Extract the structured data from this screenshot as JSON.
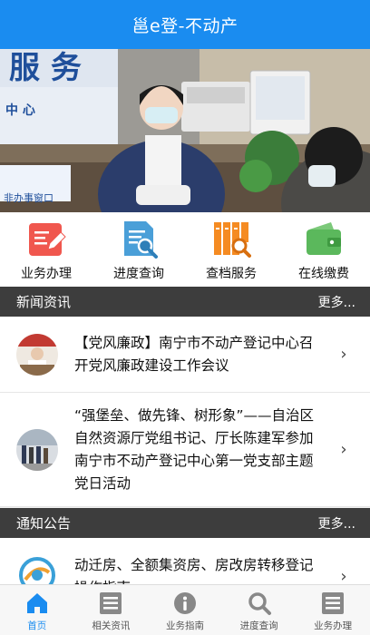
{
  "header": {
    "title": "邕e登-不动产"
  },
  "banner": {
    "sign_big": "服 务",
    "sign_small": "中 心",
    "desk_label": "非办事窗口"
  },
  "quick_actions": [
    {
      "label": "业务办理",
      "icon": "edit-icon",
      "color": "#f0574e"
    },
    {
      "label": "进度查询",
      "icon": "document-search-icon",
      "color": "#4a9fd8"
    },
    {
      "label": "查档服务",
      "icon": "archive-search-icon",
      "color": "#f58b22"
    },
    {
      "label": "在线缴费",
      "icon": "wallet-icon",
      "color": "#5bb85c"
    }
  ],
  "news_section": {
    "title": "新闻资讯",
    "more": "更多...",
    "items": [
      {
        "text": "【党风廉政】南宁市不动产登记中心召开党风廉政建设工作会议"
      },
      {
        "text": "“强堡垒、做先锋、树形象”——自治区自然资源厅党组书记、厅长陈建军参加南宁市不动产登记中心第一党支部主题党日活动"
      }
    ]
  },
  "notice_section": {
    "title": "通知公告",
    "more": "更多...",
    "items": [
      {
        "text": "动迁房、全额集资房、房改房转移登记操作指南"
      }
    ]
  },
  "tabbar": [
    {
      "label": "首页",
      "icon": "home-icon",
      "active": true
    },
    {
      "label": "相关资讯",
      "icon": "list-icon",
      "active": false
    },
    {
      "label": "业务指南",
      "icon": "info-icon",
      "active": false
    },
    {
      "label": "进度查询",
      "icon": "search-icon",
      "active": false
    },
    {
      "label": "业务办理",
      "icon": "list-icon",
      "active": false
    }
  ],
  "colors": {
    "brand": "#1a8cf0",
    "section_header": "#3d3d3d"
  }
}
